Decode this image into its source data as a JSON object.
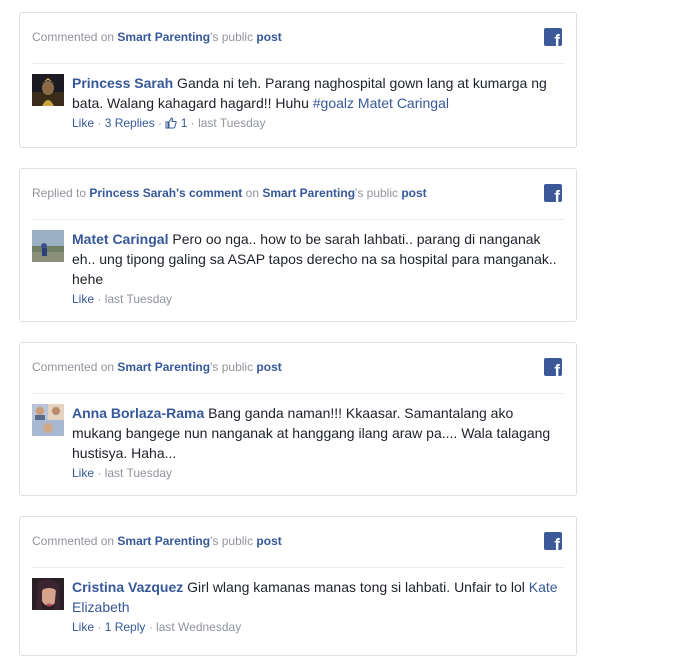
{
  "cards": [
    {
      "head": {
        "pre": "Commented on ",
        "page": "Smart Parenting",
        "mid": "'s public ",
        "post": "post"
      },
      "author": "Princess Sarah",
      "text": " Ganda ni teh. Parang naghospital gown lang at kumarga ng bata. Walang kahagard hagard!! Huhu ",
      "hashtag": "#goalz",
      "tag": "Matet Caringal",
      "meta": {
        "like": "Like",
        "replies": "3 Replies",
        "count": "1",
        "time": "last Tuesday"
      }
    },
    {
      "head": {
        "pre": "Replied to ",
        "target": "Princess Sarah's comment",
        "on": " on ",
        "page": "Smart Parenting",
        "mid": "'s public ",
        "post": "post"
      },
      "author": "Matet Caringal",
      "text": " Pero oo nga.. how to be sarah lahbati.. parang di nanganak eh.. ung tipong galing sa ASAP tapos derecho na sa hospital para manganak.. hehe",
      "meta": {
        "like": "Like",
        "time": "last Tuesday"
      }
    },
    {
      "head": {
        "pre": "Commented on ",
        "page": "Smart Parenting",
        "mid": "'s public ",
        "post": "post"
      },
      "author": "Anna Borlaza-Rama",
      "text": " Bang ganda naman!!! Kkaasar. Samantalang ako mukang bangege nun nanganak at hanggang ilang araw pa.... Wala talagang hustisya. Haha...",
      "meta": {
        "like": "Like",
        "time": "last Tuesday"
      }
    },
    {
      "head": {
        "pre": "Commented on ",
        "page": "Smart Parenting",
        "mid": "'s public ",
        "post": "post"
      },
      "author": "Cristina Vazquez",
      "text": " Girl wlang kamanas manas tong si lahbati. Unfair to lol ",
      "tag": "Kate Elizabeth",
      "meta": {
        "like": "Like",
        "replies": "1 Reply",
        "time": "last Wednesday"
      }
    }
  ],
  "icons": {
    "facebook": "f"
  },
  "colors": {
    "link": "#365899",
    "muted": "#90949c",
    "fb": "#3b5998",
    "border": "#dddfe2"
  }
}
